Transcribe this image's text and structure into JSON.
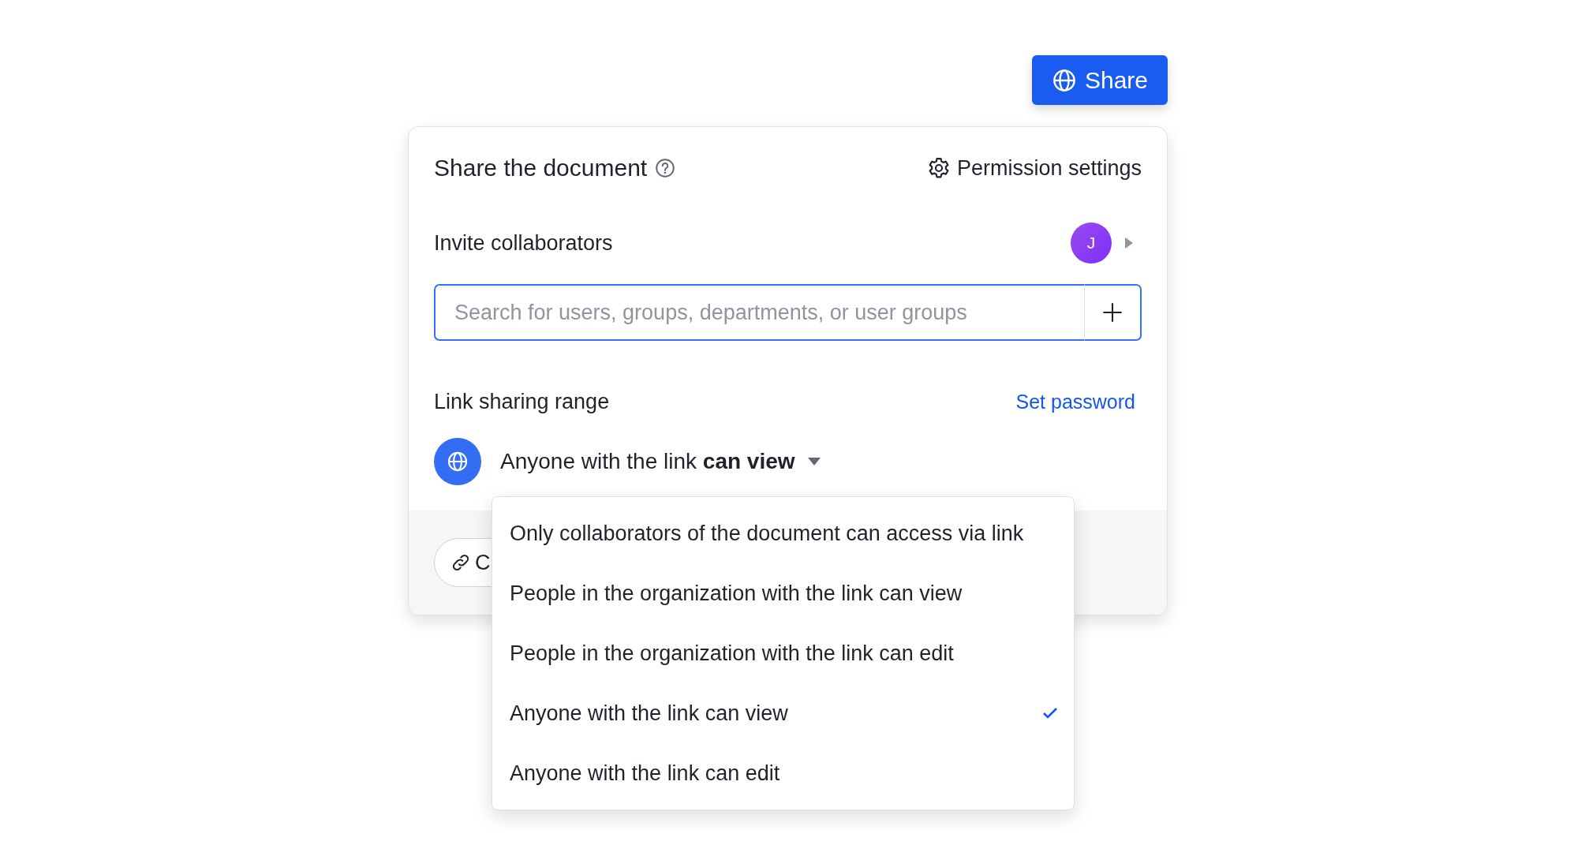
{
  "share_button": {
    "label": "Share"
  },
  "panel": {
    "title": "Share the document",
    "permission_settings": "Permission settings",
    "invite": {
      "label": "Invite collaborators",
      "avatar": "J",
      "search": {
        "placeholder": "Search for users, groups, departments, or user groups"
      }
    },
    "link_sharing": {
      "label": "Link sharing range",
      "set_password": "Set password",
      "current": "Anyone with the link **can view**",
      "expanded": true,
      "options": [
        {
          "label": "Only collaborators of the document can access via link",
          "selected": false
        },
        {
          "label": "People in the organization with the link can view",
          "selected": false
        },
        {
          "label": "People in the organization with the link can edit",
          "selected": false
        },
        {
          "label": "Anyone with the link can view",
          "selected": true
        },
        {
          "label": "Anyone with the link can edit",
          "selected": false
        }
      ]
    },
    "copy_button": {
      "label": "C"
    }
  }
}
